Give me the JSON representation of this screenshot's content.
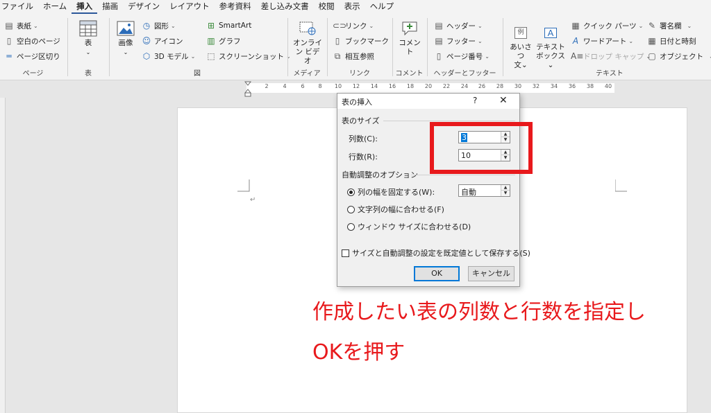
{
  "menubar": {
    "items": [
      "ファイル",
      "ホーム",
      "挿入",
      "描画",
      "デザイン",
      "レイアウト",
      "参考資料",
      "差し込み文書",
      "校閲",
      "表示",
      "ヘルプ"
    ],
    "active": "挿入"
  },
  "ribbon": {
    "pages": {
      "cover": "表紙",
      "blank": "空白のページ",
      "break": "ページ区切り",
      "label": "ページ"
    },
    "table": {
      "btn": "表",
      "label": "表"
    },
    "illust": {
      "picture": "画像",
      "shapes": "図形",
      "icons": "アイコン",
      "models": "3D モデル",
      "smartart": "SmartArt",
      "chart": "グラフ",
      "screenshot": "スクリーンショット",
      "label": "図"
    },
    "media": {
      "video_l1": "オンライ",
      "video_l2": "ン ビデオ",
      "label": "メディア"
    },
    "links": {
      "link": "リンク",
      "bookmark": "ブックマーク",
      "crossref": "相互参照",
      "label": "リンク"
    },
    "comments": {
      "comment": "コメント",
      "label": "コメント"
    },
    "headfoot": {
      "header": "ヘッダー",
      "footer": "フッター",
      "pagenum": "ページ番号",
      "label": "ヘッダーとフッター"
    },
    "text": {
      "greeting_l1": "あいさつ",
      "greeting_l2": "文",
      "greeting_icon": "例",
      "textbox_l1": "テキスト",
      "textbox_l2": "ボックス",
      "quickparts": "クイック パーツ",
      "wordart": "ワードアート",
      "dropcap": "ドロップ キャップ",
      "signature": "署名欄",
      "datetime": "日付と時刻",
      "object": "オブジェクト",
      "label": "テキスト"
    }
  },
  "ruler": {
    "ticks": [
      "2",
      "4",
      "6",
      "8",
      "10",
      "12",
      "14",
      "16",
      "18",
      "20",
      "22",
      "24",
      "26",
      "28",
      "30",
      "32",
      "34",
      "36",
      "38",
      "40"
    ]
  },
  "dialog": {
    "title": "表の挿入",
    "help": "?",
    "close": "✕",
    "size_group": "表のサイズ",
    "cols_label": "列数(C):",
    "cols_value": "3",
    "rows_label": "行数(R):",
    "rows_value": "10",
    "autofit_group": "自動調整のオプション",
    "fixed_label": "列の幅を固定する(W):",
    "fixed_value": "自動",
    "content_label": "文字列の幅に合わせる(F)",
    "window_label": "ウィンドウ サイズに合わせる(D)",
    "remember_label": "サイズと自動調整の設定を既定値として保存する(S)",
    "ok": "OK",
    "cancel": "キャンセル"
  },
  "annotation": {
    "line1": "作成したい表の列数と行数を指定し",
    "line2": "OKを押す",
    "color": "#e8191c"
  }
}
